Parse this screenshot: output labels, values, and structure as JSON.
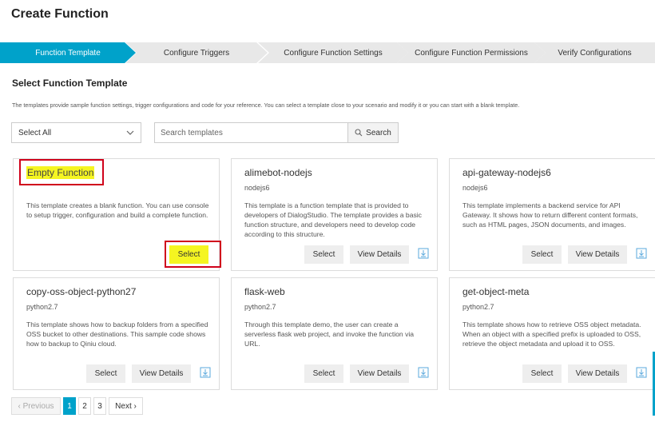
{
  "page": {
    "title": "Create Function"
  },
  "steps": [
    {
      "label": "Function Template",
      "active": true
    },
    {
      "label": "Configure Triggers",
      "active": false
    },
    {
      "label": "Configure Function Settings",
      "active": false
    },
    {
      "label": "Configure Function Permissions",
      "active": false
    },
    {
      "label": "Verify Configurations",
      "active": false
    }
  ],
  "section": {
    "title": "Select Function Template",
    "description": "The templates provide sample function settings, trigger configurations and code for your reference. You can select a template close to your scenario and modify it or you can start with a blank template."
  },
  "filter": {
    "selected": "Select All"
  },
  "search": {
    "placeholder": "Search templates",
    "button_label": "Search"
  },
  "cards": [
    {
      "title": "Empty Function",
      "runtime": "",
      "description": "This template creates a blank function. You can use console to setup trigger, configuration and build a complete function.",
      "select_label": "Select",
      "details_label": ""
    },
    {
      "title": "alimebot-nodejs",
      "runtime": "nodejs6",
      "description": "This template is a function template that is provided to developers of DialogStudio. The template provides a basic function structure, and developers need to develop code according to this structure.",
      "select_label": "Select",
      "details_label": "View Details"
    },
    {
      "title": "api-gateway-nodejs6",
      "runtime": "nodejs6",
      "description": "This template shows how to return different content formats, such as HTML pages, JSON documents, and images.",
      "select_label": "Select",
      "details_label": "View Details",
      "description_prefix": "This template implements a backend service for API Gateway. It shows how to return different content formats, such as HTML pages, JSON documents, and images."
    },
    {
      "title": "copy-oss-object-python27",
      "runtime": "python2.7",
      "description": "This template shows how to backup folders from a specified OSS bucket to other destinations. This sample code shows how to backup to Qiniu cloud.",
      "select_label": "Select",
      "details_label": "View Details"
    },
    {
      "title": "flask-web",
      "runtime": "python2.7",
      "description": "Through this template demo, the user can create a serverless flask web project, and invoke the function via URL.",
      "select_label": "Select",
      "details_label": "View Details"
    },
    {
      "title": "get-object-meta",
      "runtime": "python2.7",
      "description": "This template shows how to retrieve OSS object metadata. When an object with a specified prefix is uploaded to OSS, retrieve the object metadata and upload it to OSS.",
      "select_label": "Select",
      "details_label": "View Details"
    }
  ],
  "pagination": {
    "prev_label": "Previous",
    "pages": [
      "1",
      "2",
      "3"
    ],
    "current": "1",
    "next_label": "Next"
  },
  "colors": {
    "accent": "#00a2ca",
    "highlight": "#f5f521",
    "annotation_red": "#d0021b"
  },
  "icons": {
    "dropdown": "chevron-down-icon",
    "search": "search-icon",
    "download": "download-icon",
    "prev": "chevron-left-icon",
    "next": "chevron-right-icon"
  }
}
